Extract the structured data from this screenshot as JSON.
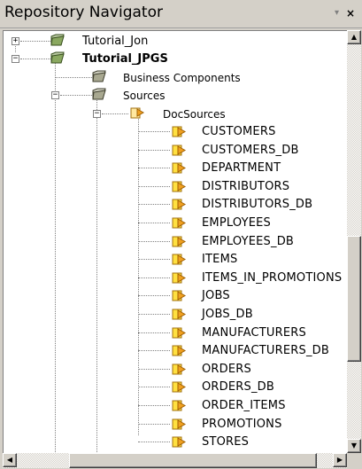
{
  "panel": {
    "title": "Repository Navigator",
    "dropdown_glyph": "▾",
    "close_glyph": "×"
  },
  "tree": {
    "projects": [
      {
        "label": "Tutorial_Jon",
        "expander": "+",
        "icon": "project-folder-icon"
      },
      {
        "label": "Tutorial_JPGS",
        "expander": "−",
        "icon": "project-folder-icon"
      }
    ],
    "jpgs_children": [
      {
        "label": "Business Components",
        "icon": "folder-icon"
      },
      {
        "label": "Sources",
        "expander": "−",
        "icon": "folder-icon"
      }
    ],
    "source_folder": {
      "label": "DocSources",
      "expander": "−",
      "icon": "datasource-icon"
    },
    "tables": [
      "CUSTOMERS",
      "CUSTOMERS_DB",
      "DEPARTMENT",
      "DISTRIBUTORS",
      "DISTRIBUTORS_DB",
      "EMPLOYEES",
      "EMPLOYEES_DB",
      "ITEMS",
      "ITEMS_IN_PROMOTIONS",
      "JOBS",
      "JOBS_DB",
      "MANUFACTURERS",
      "MANUFACTURERS_DB",
      "ORDERS",
      "ORDERS_DB",
      "ORDER_ITEMS",
      "PROMOTIONS",
      "STORES"
    ]
  },
  "scrollbars": {
    "up_glyph": "▲",
    "down_glyph": "▼",
    "left_glyph": "◀",
    "right_glyph": "▶"
  },
  "colors": {
    "folder_green": "#5a7a3a",
    "datasource_orange": "#f0a020",
    "datasource_yellow": "#ffe040"
  }
}
